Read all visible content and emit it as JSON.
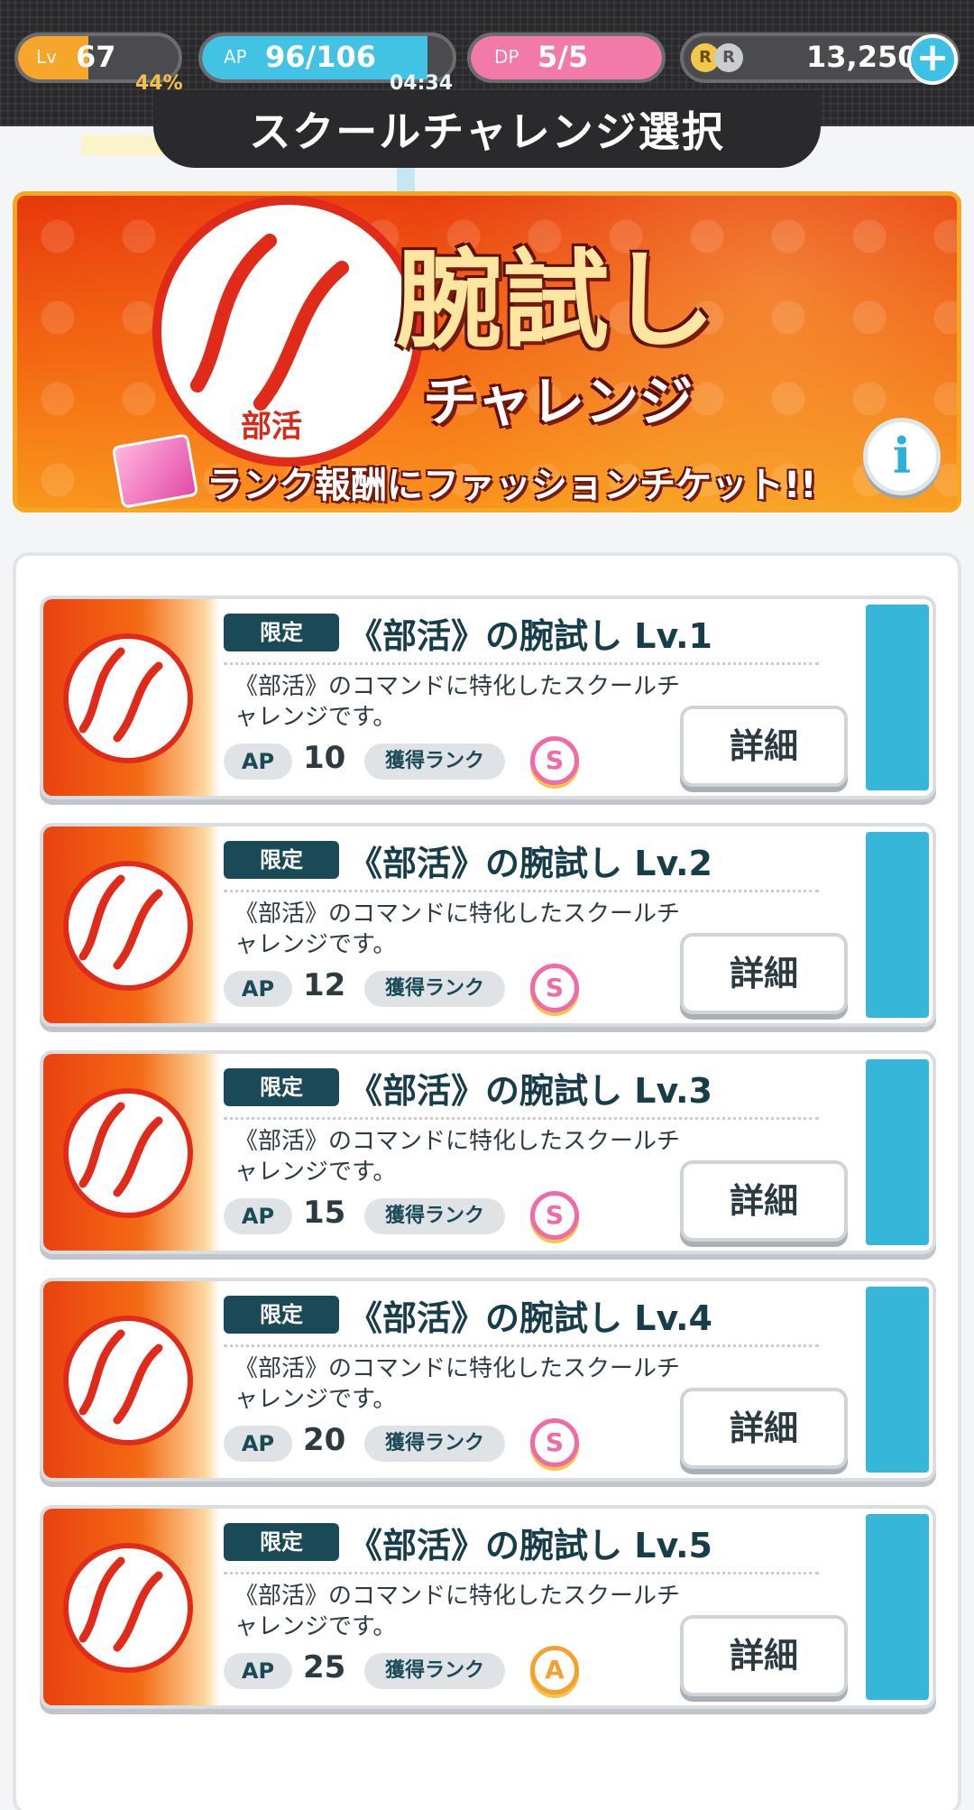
{
  "status": {
    "level_label": "Lv",
    "level_value": "67",
    "level_percent": "44%",
    "level_progress": 0.44,
    "ap_label": "AP",
    "ap_value": "96/106",
    "ap_progress": 0.9,
    "ap_timer": "04:34",
    "dp_label": "DP",
    "dp_value": "5/5",
    "coin_value": "13,250",
    "coin_icon": "coin-icon",
    "add_icon": "plus-icon"
  },
  "page": {
    "title": "スクールチャレンジ選択"
  },
  "banner": {
    "emblem_label": "部活",
    "title": "腕試し",
    "subtitle": "チャレンジ",
    "reward_text": "ランク報酬にファッションチケット!!",
    "info_icon": "info-icon",
    "info_glyph": "i"
  },
  "labels": {
    "tag": "限定",
    "ap": "AP",
    "rank": "獲得ランク",
    "detail": "詳細"
  },
  "challenges": [
    {
      "title": "《部活》の腕試し Lv.1",
      "description": "《部活》のコマンドに特化したスクールチャレンジです。",
      "ap": "10",
      "rank": "S"
    },
    {
      "title": "《部活》の腕試し Lv.2",
      "description": "《部活》のコマンドに特化したスクールチャレンジです。",
      "ap": "12",
      "rank": "S"
    },
    {
      "title": "《部活》の腕試し Lv.3",
      "description": "《部活》のコマンドに特化したスクールチャレンジです。",
      "ap": "15",
      "rank": "S"
    },
    {
      "title": "《部活》の腕試し Lv.4",
      "description": "《部活》のコマンドに特化したスクールチャレンジです。",
      "ap": "20",
      "rank": "S"
    },
    {
      "title": "《部活》の腕試し Lv.5",
      "description": "《部活》のコマンドに特化したスクールチャレンジです。",
      "ap": "25",
      "rank": "A"
    }
  ],
  "colors": {
    "level_fill": "#f5a62b",
    "ap_fill": "#43c3e3",
    "dp_fill": "#f27aa8",
    "accent": "#36b6d8",
    "tag_bg": "#1a4a58"
  }
}
